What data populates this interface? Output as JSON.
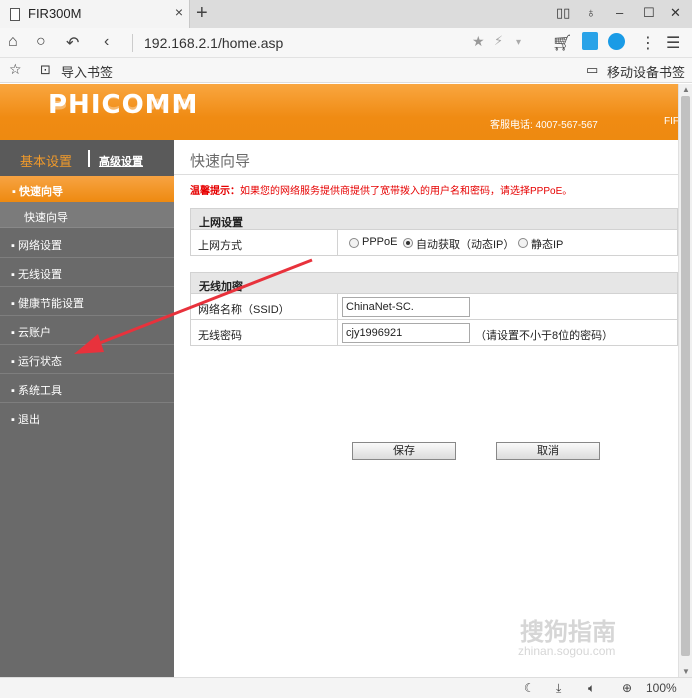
{
  "browser": {
    "tab_title": "FIR300M",
    "tab_close": "×",
    "new_tab": "+",
    "url": "192.168.2.1/home.asp",
    "bookmark_import": "导入书签",
    "mobile_bookmarks": "移动设备书签",
    "zoom": "100%"
  },
  "router": {
    "logo": "PHICOMM",
    "hotline": "客服电话: 4007-567-567",
    "model_cut": "FIF",
    "sidebar": {
      "tab_basic": "基本设置",
      "tab_advanced": "高级设置",
      "active_item": "▪ 快速向导",
      "sub_item": "快速向导",
      "items": [
        "▪ 网络设置",
        "▪ 无线设置",
        "▪ 健康节能设置",
        "▪ 云账户",
        "▪ 运行状态",
        "▪ 系统工具",
        "▪ 退出"
      ]
    },
    "content": {
      "title": "快速向导",
      "tip_label": "温馨提示：",
      "tip_text": "如果您的网络服务提供商提供了宽带拨入的用户名和密码，请选择PPPoE。",
      "net_section": "上网设置",
      "net_mode_label": "上网方式",
      "options": [
        "PPPoE",
        "自动获取（动态IP）",
        "静态IP"
      ],
      "selected_option": "自动获取（动态IP）",
      "wireless_section": "无线加密",
      "ssid_label": "网络名称（SSID）",
      "ssid_value": "ChinaNet-SC.",
      "password_label": "无线密码",
      "password_value": "cjy1996921",
      "password_hint": "（请设置不小于8位的密码）",
      "save_button": "保存",
      "cancel_button": "取消"
    }
  },
  "watermark": {
    "main": "搜狗指南",
    "sub": "zhinan.sogou.com"
  },
  "colors": {
    "orange": "#f08b13",
    "sidebar": "#6a6a6a",
    "tip": "#e60000",
    "arrow": "#e8323c"
  }
}
